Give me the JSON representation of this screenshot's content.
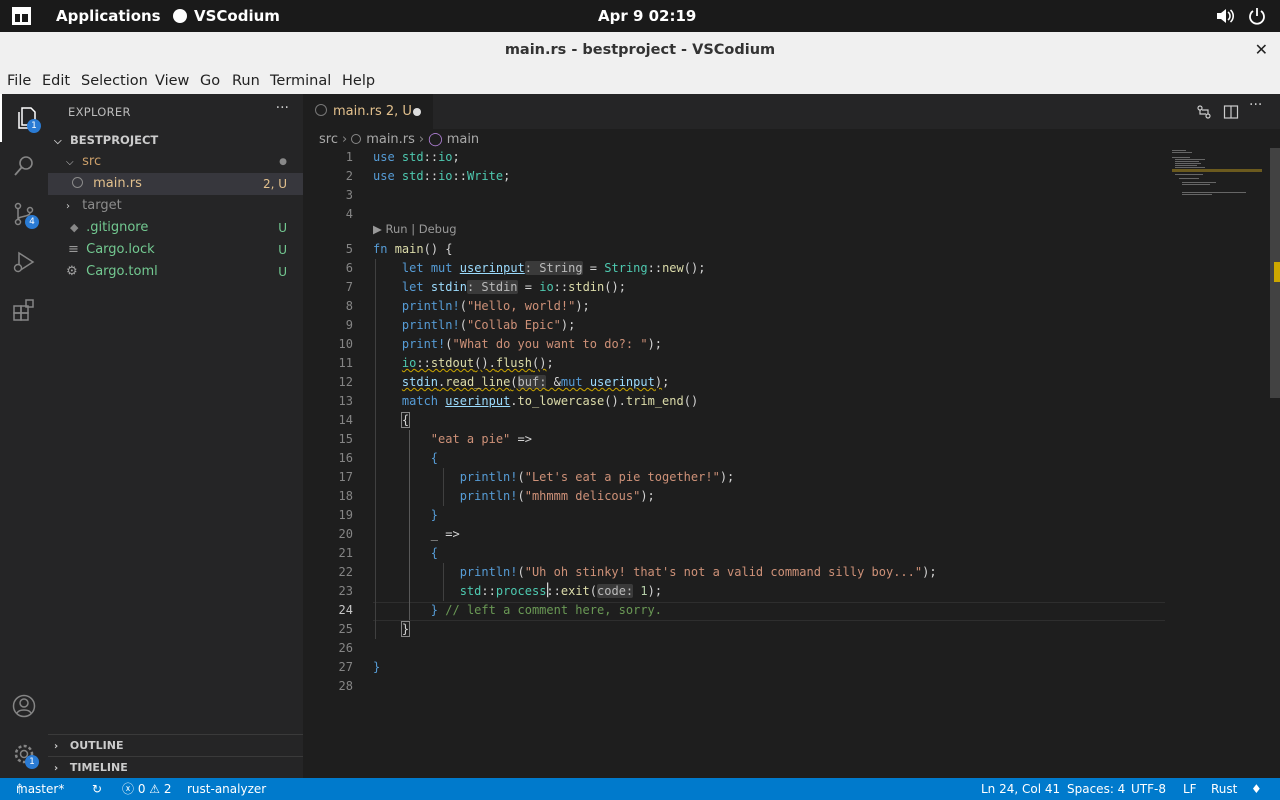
{
  "system_bar": {
    "applications": "Applications",
    "active_app": "VSCodium",
    "clock": "Apr 9  02:19"
  },
  "window": {
    "title": "main.rs - bestproject - VSCodium",
    "close": "✕"
  },
  "menu": [
    "File",
    "Edit",
    "Selection",
    "View",
    "Go",
    "Run",
    "Terminal",
    "Help"
  ],
  "activity_bar": {
    "explorer_badge": "1",
    "scm_badge": "4",
    "settings_badge": "1"
  },
  "explorer": {
    "header": "EXPLORER",
    "more": "···",
    "project": "BESTPROJECT",
    "items": [
      {
        "label": "src",
        "deco": "●"
      },
      {
        "label": "main.rs",
        "deco": "2, U"
      },
      {
        "label": "target",
        "deco": ""
      },
      {
        "label": ".gitignore",
        "deco": "U"
      },
      {
        "label": "Cargo.lock",
        "deco": "U"
      },
      {
        "label": "Cargo.toml",
        "deco": "U"
      }
    ],
    "outline": "OUTLINE",
    "timeline": "TIMELINE"
  },
  "tab": {
    "label": "main.rs  2, U"
  },
  "breadcrumb": {
    "folder": "src",
    "file": "main.rs",
    "symbol": "main"
  },
  "codelens": "▶ Run | Debug",
  "line_numbers": [
    "1",
    "2",
    "3",
    "4",
    "5",
    "6",
    "7",
    "8",
    "9",
    "10",
    "11",
    "12",
    "13",
    "14",
    "15",
    "16",
    "17",
    "18",
    "19",
    "20",
    "21",
    "22",
    "23",
    "24",
    "25",
    "26",
    "27",
    "28"
  ],
  "current_line": "24",
  "code": {
    "l1": "use std::io;",
    "l2": "use std::io::Write;",
    "l8_str": "\"Hello, world!\"",
    "l9_str": "\"Collab Epic\"",
    "l10_str": "\"What do you want to do?: \"",
    "l15_str": "\"eat a pie\"",
    "l17_str": "\"Let's eat a pie together!\"",
    "l18_str": "\"mhmmm delicous\"",
    "l22_str": "\"Uh oh stinky! that's not a valid command silly boy...\"",
    "l24_comment": "// left a comment here, sorry."
  },
  "status_bar": {
    "branch": "master*",
    "problems": "ⓧ 0 ⚠ 2",
    "lsp": "rust-analyzer",
    "position": "Ln 24, Col 41",
    "spaces": "Spaces: 4",
    "encoding": "UTF-8",
    "eol": "LF",
    "language": "Rust"
  }
}
